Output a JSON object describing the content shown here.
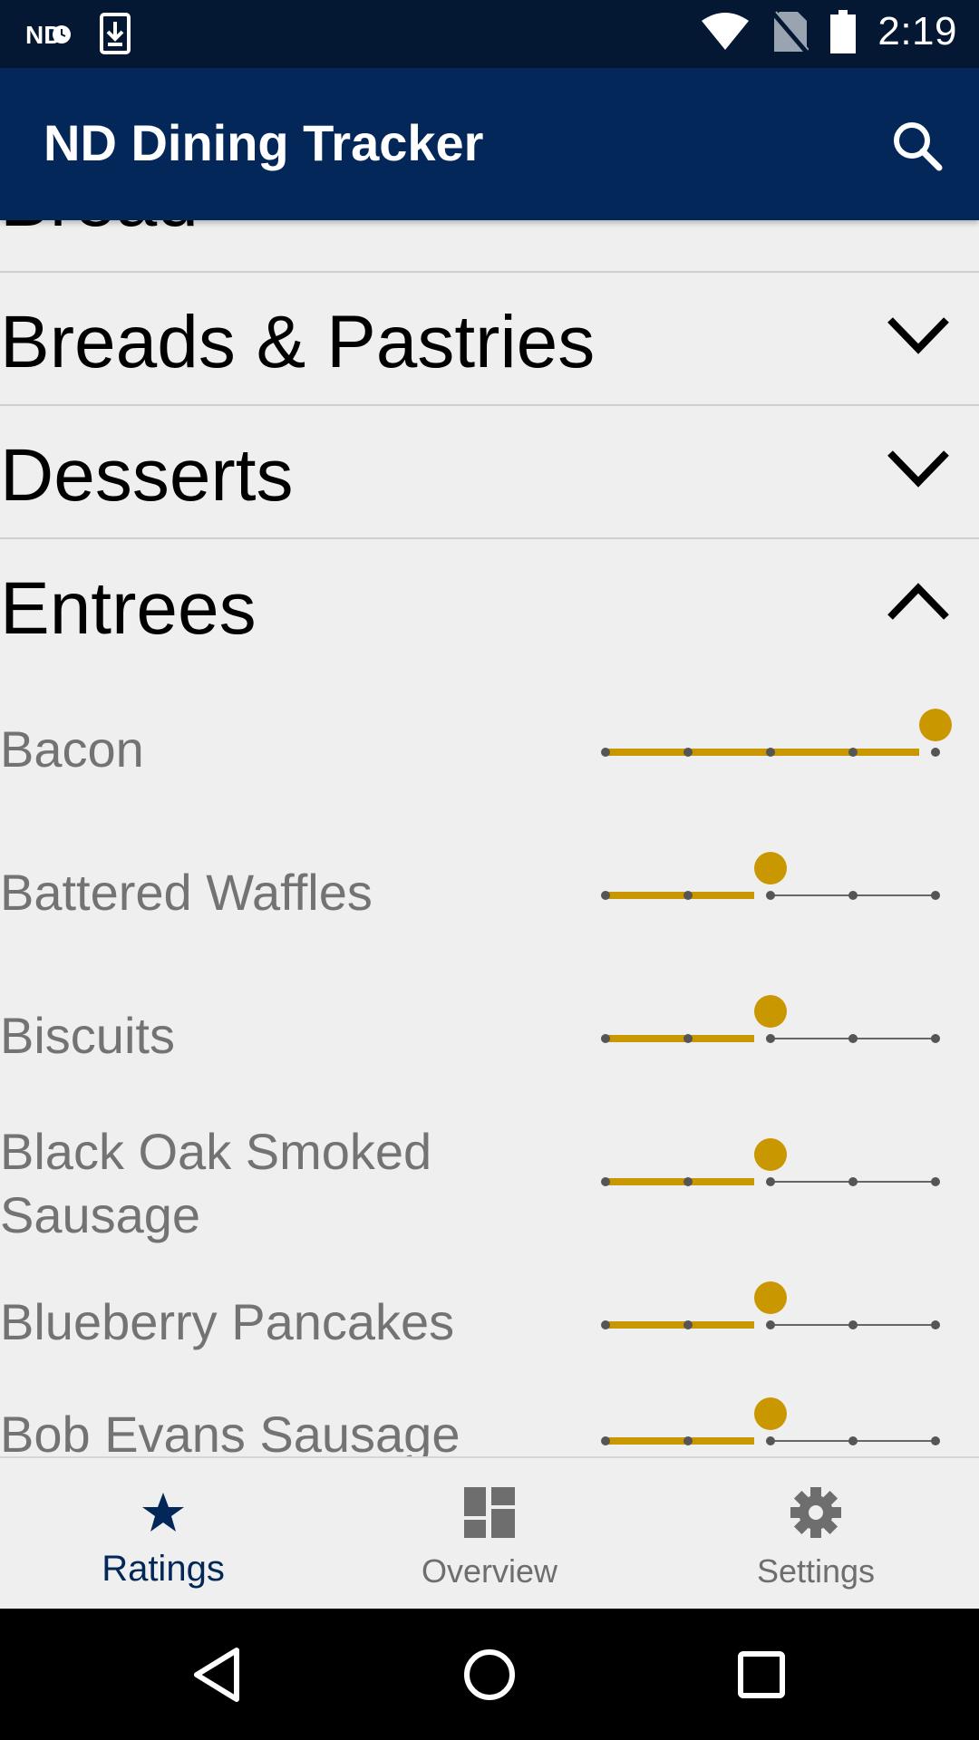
{
  "status_bar": {
    "left_icons": [
      "nd-notification-icon",
      "download-icon"
    ],
    "right_icons": [
      "wifi-icon",
      "no-sim-icon",
      "battery-icon"
    ],
    "time": "2:19"
  },
  "app_bar": {
    "title": "ND Dining Tracker",
    "search_icon": "search-icon"
  },
  "categories": [
    {
      "label": "Bread",
      "expanded": false,
      "partially_visible": true
    },
    {
      "label": "Breads & Pastries",
      "expanded": false
    },
    {
      "label": "Desserts",
      "expanded": false
    },
    {
      "label": "Entrees",
      "expanded": true
    }
  ],
  "items": [
    {
      "name": "Bacon",
      "rating": 5,
      "max": 5
    },
    {
      "name": "Battered Waffles",
      "rating": 3,
      "max": 5
    },
    {
      "name": "Biscuits",
      "rating": 3,
      "max": 5
    },
    {
      "name": "Black Oak Smoked Sausage",
      "rating": 3,
      "max": 5
    },
    {
      "name": "Blueberry Pancakes",
      "rating": 3,
      "max": 5
    },
    {
      "name": "Bob Evans Sausage",
      "rating": 3,
      "max": 5
    }
  ],
  "bottom_nav": [
    {
      "label": "Ratings",
      "icon": "star-icon",
      "active": true
    },
    {
      "label": "Overview",
      "icon": "dashboard-icon",
      "active": false
    },
    {
      "label": "Settings",
      "icon": "gear-icon",
      "active": false
    }
  ],
  "colors": {
    "status_bar": "#041733",
    "app_bar": "#022758",
    "accent_gold": "#c99700",
    "background": "#efefef"
  }
}
